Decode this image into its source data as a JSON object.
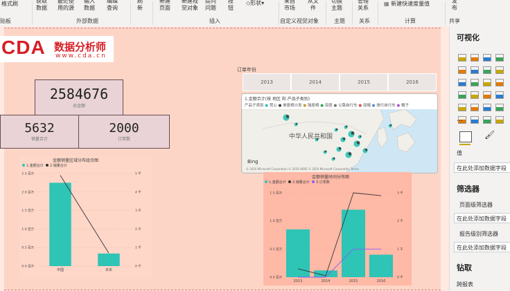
{
  "ribbon": {
    "clip_left": "格式刷",
    "clip_group": "贴板",
    "get_data": "获取\n数据",
    "recent_sources": "最近使\n用的源",
    "enter_data": "输入\n数据",
    "edit_queries": "编辑\n查询",
    "external_group": "外部数据",
    "refresh": "刷\n新",
    "new_page": "新建\n页面",
    "new_visual": "新建视\n觉对象",
    "ask_question": "提问\n问题",
    "buttons": "按\n钮",
    "shapes": "形状",
    "insert_group": "插入",
    "marketplace": "来自\n市场",
    "from_file": "从文\n件",
    "custom_visual_group": "自定义视觉对象",
    "switch_theme": "切换\n主题",
    "theme_group": "主题",
    "manage_relations": "管理\n关系",
    "relations_group": "关系",
    "new_quick_measure": "新建快速度量值",
    "calc_group": "计算",
    "publish": "发\n布",
    "share_group": "共享"
  },
  "report": {
    "logo_text": "CDA",
    "logo_cn": "数据分析师",
    "logo_url": "www.cda.cn",
    "card_total": {
      "value": "2584676",
      "label": "总金额"
    },
    "card_qty": {
      "value": "5632",
      "label": "销量合计"
    },
    "card_orders": {
      "value": "2000",
      "label": "订单数"
    },
    "slicer_title": "订单年份",
    "years": [
      "2013",
      "2014",
      "2015",
      "2016"
    ],
    "map_title": "1.金额合计(按 地区 和 产品子类别)",
    "map_legend_prefix": "产品子类别",
    "map_legend_items": [
      "凳心",
      "单座椅沙发",
      "独座椅",
      "双座",
      "公路自行车",
      "连帽",
      "旅行自行车",
      "帽子"
    ],
    "map_country": "中华人民共和国",
    "map_bing": "Bing",
    "map_copyright": "© 2020 Microsoft Corporation  © 2020 HERE  © 2020 Microsoft Corporation  Terms",
    "chart1_title": "金额销量区域分布组合图",
    "chart1_legend": [
      "1.金额合计",
      "2.销量合计"
    ],
    "chart2_title": "金额销量时间分布图",
    "chart2_legend": [
      "1.金额合计",
      "2.销量合计",
      "3.订单数"
    ]
  },
  "panel": {
    "visualize": "可视化",
    "values_label": "值",
    "add_field_1": "在此处添加数据字段",
    "filters": "筛选器",
    "page_filters": "页面级筛选器",
    "add_field_2": "在此处添加数据字段",
    "report_filters": "报告级别筛选器",
    "add_field_3": "在此处添加数据字段",
    "drill": "钻取",
    "cross_report": "跨报表",
    "more": "..."
  },
  "colors": {
    "teal": "#2ec4b6",
    "line_dark": "#333333",
    "line_purple": "#8a5cf6",
    "accent_red": "#d61f26"
  },
  "chart_data": [
    {
      "type": "bar",
      "title": "金额销量区域分布组合图",
      "categories": [
        "中国",
        "日本"
      ],
      "series": [
        {
          "name": "1.金额合计",
          "kind": "bar",
          "values": [
            2250000,
            340000
          ]
        },
        {
          "name": "2.销量合计",
          "kind": "line",
          "values": [
            4900,
            700
          ]
        }
      ],
      "y_ticks_left": [
        "0.0 百万",
        "0.5 百万",
        "1.0 百万",
        "1.5 百万",
        "2.0 百万",
        "2.5 百万"
      ],
      "y_ticks_right": [
        "0 千",
        "1 千",
        "2 千",
        "3 千",
        "4 千",
        "5 千"
      ],
      "ylim": [
        0,
        2500000
      ],
      "y2lim": [
        0,
        5000
      ]
    },
    {
      "type": "bar",
      "title": "金额销量时间分布图",
      "categories": [
        "2013",
        "2014",
        "2015",
        "2016"
      ],
      "series": [
        {
          "name": "1.金额合计",
          "kind": "bar",
          "values": [
            850000,
            120000,
            1200000,
            400000
          ]
        },
        {
          "name": "2.销量合计",
          "kind": "line",
          "values": [
            300,
            50,
            3000,
            2900
          ]
        },
        {
          "name": "3.订单数",
          "kind": "line",
          "values": [
            0,
            0,
            1000,
            1000
          ]
        }
      ],
      "y_ticks_left": [
        "0.0 百万",
        "0.5 百万",
        "1.0 百万",
        "1.5 百万"
      ],
      "y_ticks_right": [
        "0 千",
        "1 千",
        "2 千",
        "3 千"
      ],
      "ylim": [
        0,
        1500000
      ],
      "y2lim": [
        0,
        3000
      ]
    }
  ]
}
